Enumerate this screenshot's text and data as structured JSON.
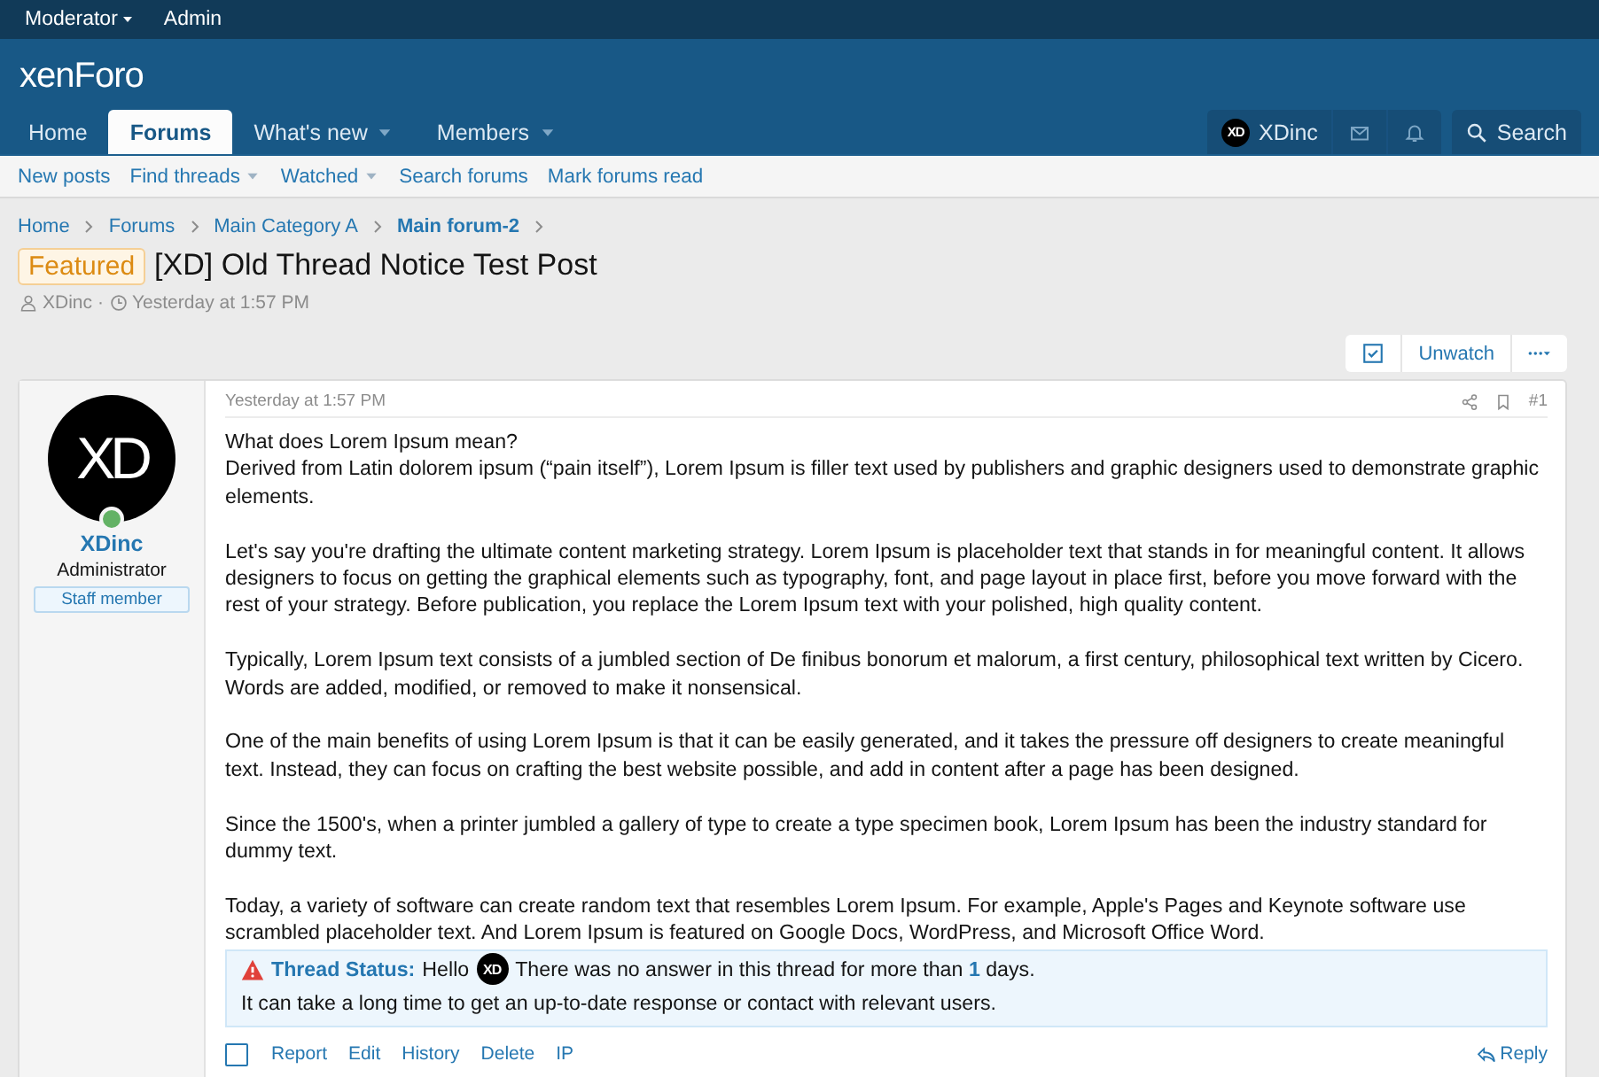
{
  "staff_bar": [
    {
      "label": "Moderator",
      "has_menu": true
    },
    {
      "label": "Admin",
      "has_menu": false
    }
  ],
  "header": {
    "logo": "xenForo"
  },
  "nav": {
    "tabs": [
      {
        "label": "Home",
        "selected": false,
        "has_menu": false
      },
      {
        "label": "Forums",
        "selected": true,
        "has_menu": false
      },
      {
        "label": "What's new",
        "selected": false,
        "has_menu": true
      },
      {
        "label": "Members",
        "selected": false,
        "has_menu": true
      }
    ],
    "account": {
      "avatar": "XD",
      "name": "XDinc"
    },
    "search": "Search"
  },
  "subnav": [
    {
      "label": "New posts",
      "has_menu": false
    },
    {
      "label": "Find threads",
      "has_menu": true
    },
    {
      "label": "Watched",
      "has_menu": true
    },
    {
      "label": "Search forums",
      "has_menu": false
    },
    {
      "label": "Mark forums read",
      "has_menu": false
    }
  ],
  "breadcrumb": [
    {
      "label": "Home",
      "current": false
    },
    {
      "label": "Forums",
      "current": false
    },
    {
      "label": "Main Category A",
      "current": false
    },
    {
      "label": "Main forum-2",
      "current": true
    }
  ],
  "thread": {
    "prefix": "Featured",
    "title": "[XD] Old Thread Notice Test Post",
    "author": "XDinc",
    "separator": "·",
    "date": "Yesterday at 1:57 PM"
  },
  "thread_actions": {
    "moderation_checked": true,
    "watch": "Unwatch"
  },
  "post": {
    "user": {
      "avatar": "XD",
      "name": "XDinc",
      "title": "Administrator",
      "banner": "Staff member",
      "online": true
    },
    "date": "Yesterday at 1:57 PM",
    "number": "#1",
    "paragraphs": [
      [
        "What does Lorem Ipsum mean?",
        "Derived from Latin dolorem ipsum (“pain itself”), Lorem Ipsum is filler text used by publishers and graphic designers used to demonstrate graphic elements."
      ],
      [
        "Let's say you're drafting the ultimate content marketing strategy. Lorem Ipsum is placeholder text that stands in for meaningful content. It allows designers to focus on getting the graphical elements such as typography, font, and page layout in place first, before you move forward with the rest of your strategy. Before publication, you replace the Lorem Ipsum text with your polished, high quality content."
      ],
      [
        "Typically, Lorem Ipsum text consists of a jumbled section of De finibus bonorum et malorum, a first century, philosophical text written by Cicero. Words are added, modified, or removed to make it nonsensical."
      ],
      [
        "One of the main benefits of using Lorem Ipsum is that it can be easily generated, and it takes the pressure off designers to create meaningful text. Instead, they can focus on crafting the best website possible, and add in content after a page has been designed."
      ],
      [
        "Since the 1500's, when a printer jumbled a gallery of type to create a type specimen book, Lorem Ipsum has been the industry standard for dummy text."
      ],
      [
        "Today, a variety of software can create random text that resembles Lorem Ipsum. For example, Apple's Pages and Keynote software use scrambled placeholder text. And Lorem Ipsum is featured on Google Docs, WordPress, and Microsoft Office Word."
      ]
    ],
    "notice": {
      "label": "Thread Status:",
      "greeting": "Hello",
      "avatar": "XD",
      "message": "There was no answer in this thread for more than **1** days.",
      "line2": "It can take a long time to get an up-to-date response or contact with relevant users."
    },
    "selected": false,
    "actions": [
      "Report",
      "Edit",
      "History",
      "Delete",
      "IP"
    ],
    "reply": "Reply"
  }
}
